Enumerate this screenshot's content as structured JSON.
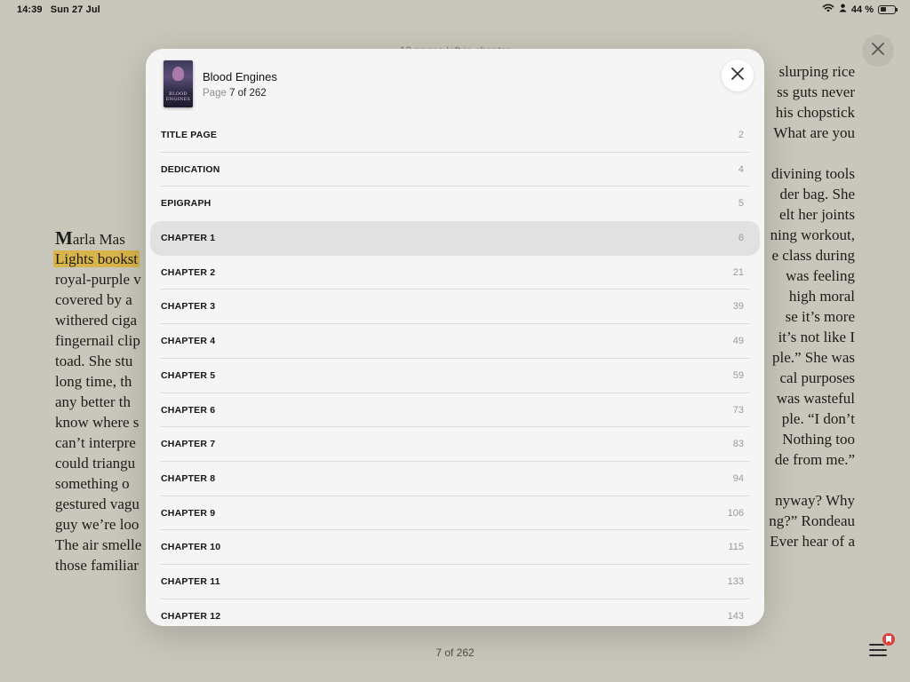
{
  "status_bar": {
    "time": "14:39",
    "date": "Sun 27 Jul",
    "battery_text": "44 %",
    "battery_level": 0.44
  },
  "reader": {
    "header_text": "12 pages left in chapter",
    "footer_text": "7 of 262",
    "left_lines": [
      "arla Mas",
      "Lights bookst",
      "royal-purple v",
      "covered by a",
      "withered ciga",
      "fingernail clip",
      "toad. She stu",
      "long time, th",
      "any better th",
      "know where s",
      "can’t interpre",
      "could triangu",
      "something o",
      "gestured vagu",
      "guy we’re loo",
      "The air smelle",
      "those familiar"
    ],
    "drop_cap": "M",
    "right_lines": [
      "slurping rice",
      "ss guts never",
      "his chopstick",
      "What are you",
      "",
      "divining tools",
      "der bag. She",
      "elt her joints",
      "ning workout,",
      "e class during",
      "was feeling",
      "high moral",
      "se it’s more",
      "it’s not like I",
      "ple.” She was",
      "cal purposes",
      "was wasteful",
      "ple. “I don’t",
      "Nothing too",
      "de from me.”",
      "",
      "nyway? Why",
      "ng?” Rondeau",
      "Ever hear of a"
    ]
  },
  "toc": {
    "book_title": "Blood Engines",
    "cover_text": "BLOOD ENGINES",
    "page_prefix": "Page",
    "page_value": "7 of 262",
    "items": [
      {
        "label": "TITLE PAGE",
        "page": "2"
      },
      {
        "label": "DEDICATION",
        "page": "4"
      },
      {
        "label": "EPIGRAPH",
        "page": "5"
      },
      {
        "label": "CHAPTER 1",
        "page": "6",
        "current": true
      },
      {
        "label": "CHAPTER 2",
        "page": "21"
      },
      {
        "label": "CHAPTER 3",
        "page": "39"
      },
      {
        "label": "CHAPTER 4",
        "page": "49"
      },
      {
        "label": "CHAPTER 5",
        "page": "59"
      },
      {
        "label": "CHAPTER 6",
        "page": "73"
      },
      {
        "label": "CHAPTER 7",
        "page": "83"
      },
      {
        "label": "CHAPTER 8",
        "page": "94"
      },
      {
        "label": "CHAPTER 9",
        "page": "106"
      },
      {
        "label": "CHAPTER 10",
        "page": "115"
      },
      {
        "label": "CHAPTER 11",
        "page": "133"
      },
      {
        "label": "CHAPTER 12",
        "page": "143"
      }
    ]
  },
  "icons": {
    "close": "close-icon",
    "wifi": "wifi-icon",
    "person": "person-icon",
    "battery": "battery-icon",
    "toc": "toc-list-icon",
    "bookmark_badge": "bookmark-icon"
  },
  "colors": {
    "page_background": "#c9c7bb",
    "modal_background": "#f5f5f5",
    "highlight": "#d8b44a",
    "current_row": "#e1e1e1",
    "badge": "#e0403a"
  }
}
